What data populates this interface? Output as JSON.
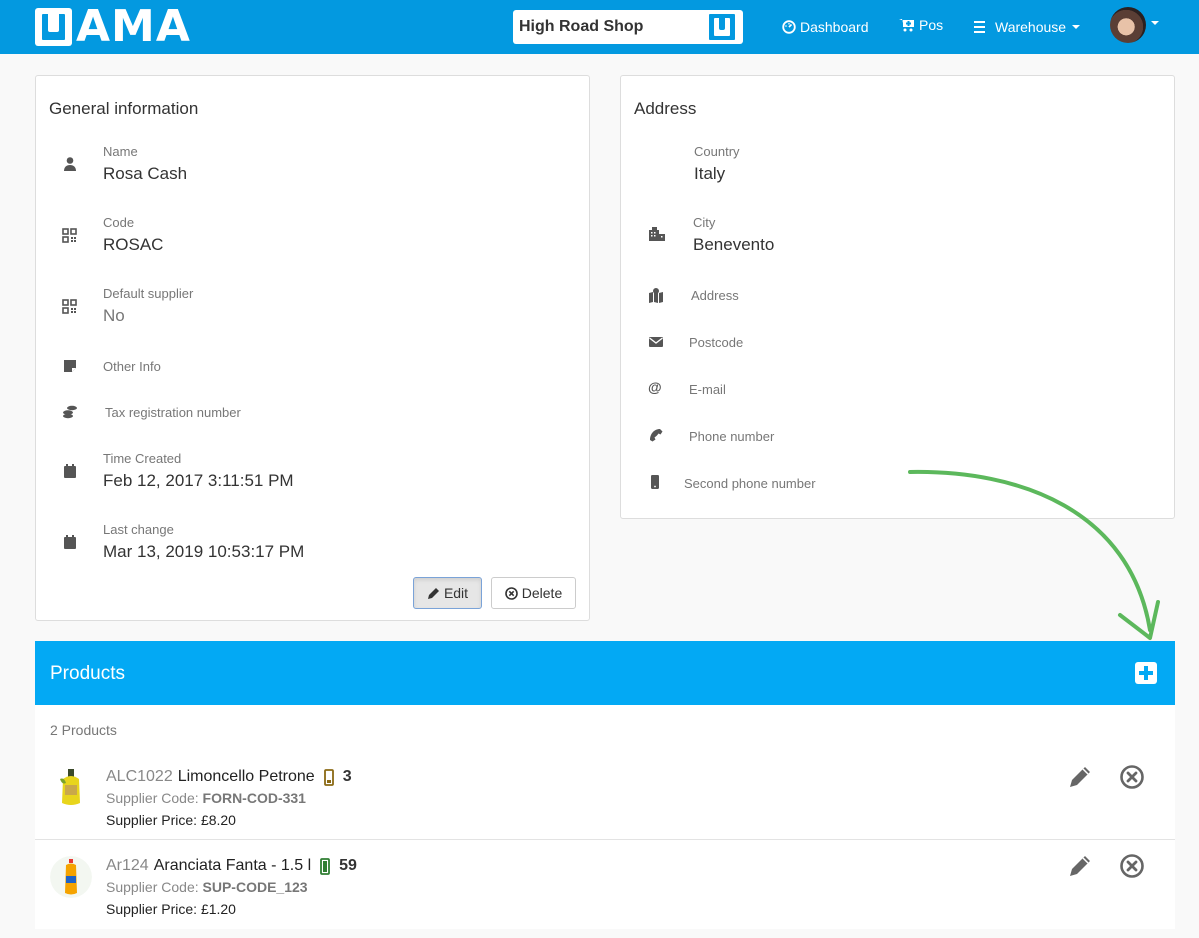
{
  "navbar": {
    "logo_text": "AMA",
    "shop_name": "High Road Shop",
    "items": [
      {
        "label": "Dashboard",
        "icon": "dashboard-icon"
      },
      {
        "label": "Pos",
        "icon": "cart-plus-icon"
      },
      {
        "label": "Warehouse",
        "icon": "bars-icon",
        "has_dropdown": true
      }
    ],
    "user_menu": {
      "icon": "avatar",
      "has_dropdown": true
    }
  },
  "general": {
    "title": "General information",
    "fields": [
      {
        "label": "Name",
        "value": "Rosa Cash",
        "icon": "user-icon"
      },
      {
        "label": "Code",
        "value": "ROSAC",
        "icon": "qrcode-icon"
      },
      {
        "label": "Default supplier",
        "value": "No",
        "icon": "qrcode-icon"
      },
      {
        "label": "Other Info",
        "value": "",
        "icon": "sticky-note-icon"
      },
      {
        "label": "Tax registration number",
        "value": "",
        "icon": "coins-icon"
      },
      {
        "label": "Time Created",
        "value": "Feb 12, 2017 3:11:51 PM",
        "icon": "calendar-icon"
      },
      {
        "label": "Last change",
        "value": "Mar 13, 2019 10:53:17 PM",
        "icon": "calendar-icon"
      }
    ],
    "edit_label": "Edit",
    "delete_label": "Delete"
  },
  "address": {
    "title": "Address",
    "fields": [
      {
        "label": "Country",
        "value": "Italy",
        "icon": ""
      },
      {
        "label": "City",
        "value": "Benevento",
        "icon": "city-icon"
      },
      {
        "label": "Address",
        "value": "",
        "icon": "map-marked-icon"
      },
      {
        "label": "Postcode",
        "value": "",
        "icon": "envelope-icon"
      },
      {
        "label": "E-mail",
        "value": "",
        "icon": "at-icon"
      },
      {
        "label": "Phone number",
        "value": "",
        "icon": "phone-icon"
      },
      {
        "label": "Second phone number",
        "value": "",
        "icon": "mobile-icon"
      }
    ]
  },
  "products": {
    "title": "Products",
    "count_label": "2 Products",
    "items": [
      {
        "code": "ALC1022",
        "name": "Limoncello Petrone",
        "stock_status": "low",
        "stock_color": "#8b6914",
        "quantity": "3",
        "supplier_code_label": "Supplier Code:",
        "supplier_code": "FORN-COD-331",
        "supplier_price_label": "Supplier Price:",
        "supplier_price": "£8.20"
      },
      {
        "code": "Ar124",
        "name": "Aranciata Fanta - 1.5 l",
        "stock_status": "full",
        "stock_color": "#2e7d32",
        "quantity": "59",
        "supplier_code_label": "Supplier Code:",
        "supplier_code": "SUP-CODE_123",
        "supplier_price_label": "Supplier Price:",
        "supplier_price": "£1.20"
      }
    ]
  },
  "colors": {
    "navbar": "#0399e0",
    "products_header": "#03a9f4",
    "annotation_arrow": "#5cb85c"
  }
}
